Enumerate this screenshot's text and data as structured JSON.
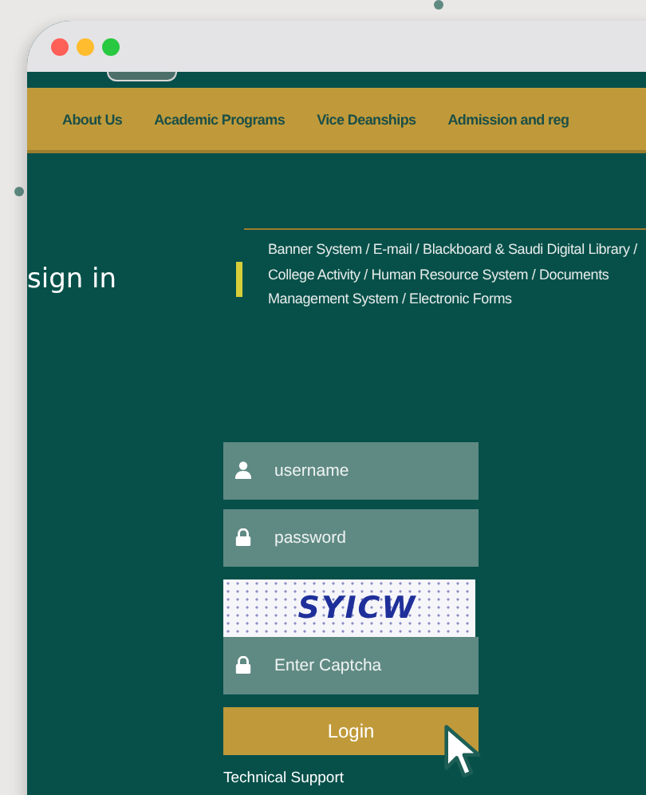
{
  "nav": {
    "items": [
      "About Us",
      "Academic Programs",
      "Vice Deanships",
      "Admission and reg"
    ]
  },
  "sign_in": {
    "title": "sign in",
    "services": "Banner System / E-mail / Blackboard & Saudi Digital Library / College Activity / Human Resource System / Documents Management System / Electronic Forms"
  },
  "form": {
    "fields": [
      {
        "kind": "username",
        "placeholder": "username"
      },
      {
        "kind": "password",
        "placeholder": "password"
      },
      {
        "kind": "captcha_image",
        "text": "SYICW"
      },
      {
        "kind": "captcha_input",
        "placeholder": "Enter Captcha"
      }
    ],
    "button": "Login",
    "support_link": "Technical Support"
  }
}
